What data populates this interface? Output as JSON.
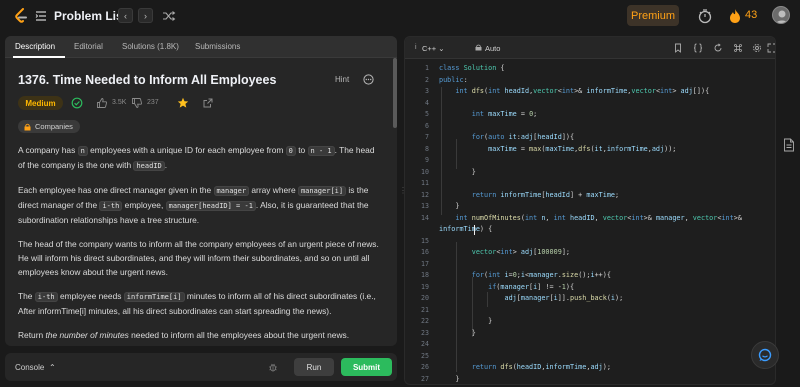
{
  "topbar": {
    "title": "Problem List",
    "premium": "Premium",
    "streak": "43"
  },
  "tabs": {
    "description": "Description",
    "editorial": "Editorial",
    "solutions": "Solutions (1.8K)",
    "submissions": "Submissions"
  },
  "problem": {
    "title": "1376. Time Needed to Inform All Employees",
    "hint": "Hint",
    "difficulty": "Medium",
    "likes": "3.5K",
    "dislikes": "237",
    "companies": "Companies"
  },
  "description": {
    "p1": [
      "A company has ",
      "n",
      " employees with a unique ID for each employee from ",
      "0",
      " to ",
      "n - 1",
      ". The head of the company is the one with ",
      "headID",
      "."
    ],
    "p2": [
      "Each employee has one direct manager given in the ",
      "manager",
      " array where ",
      "manager[i]",
      " is the direct manager of the ",
      "i-th",
      " employee, ",
      "manager[headID] = -1",
      ". Also, it is guaranteed that the subordination relationships have a tree structure."
    ],
    "p3": "The head of the company wants to inform all the company employees of an urgent piece of news. He will inform his direct subordinates, and they will inform their subordinates, and so on until all employees know about the urgent news.",
    "p4": [
      "The ",
      "i-th",
      " employee needs ",
      "informTime[i]",
      " minutes to inform all of his direct subordinates (i.e., After informTime[i] minutes, all his direct subordinates can start spreading the news)."
    ],
    "p5": [
      "Return ",
      "the number of minutes",
      " needed to inform all the employees about the urgent news."
    ]
  },
  "console": {
    "label": "Console",
    "run": "Run",
    "submit": "Submit"
  },
  "editor": {
    "language": "C++",
    "mode": "Auto",
    "line_numbers": [
      "1",
      "2",
      "3",
      "4",
      "5",
      "6",
      "7",
      "8",
      "9",
      "10",
      "11",
      "12",
      "13",
      "14",
      "15",
      "16",
      "17",
      "18",
      "19",
      "20",
      "21",
      "22",
      "23",
      "24",
      "25",
      "26",
      "27"
    ]
  },
  "icons": {
    "logo": "leetcode-logo-icon",
    "list": "list-icon",
    "prev": "chevron-left-icon",
    "next": "chevron-right-icon",
    "shuffle": "shuffle-icon",
    "timer": "timer-icon",
    "fire": "fire-icon",
    "bookmark": "bookmark-icon",
    "braces": "braces-icon",
    "reset": "reset-icon",
    "shortcut": "command-icon",
    "settings": "gear-icon",
    "fullscreen": "fullscreen-icon"
  },
  "colors": {
    "accent": "#ffa116",
    "submit": "#2cbb5d",
    "medium": "#ffb800"
  }
}
